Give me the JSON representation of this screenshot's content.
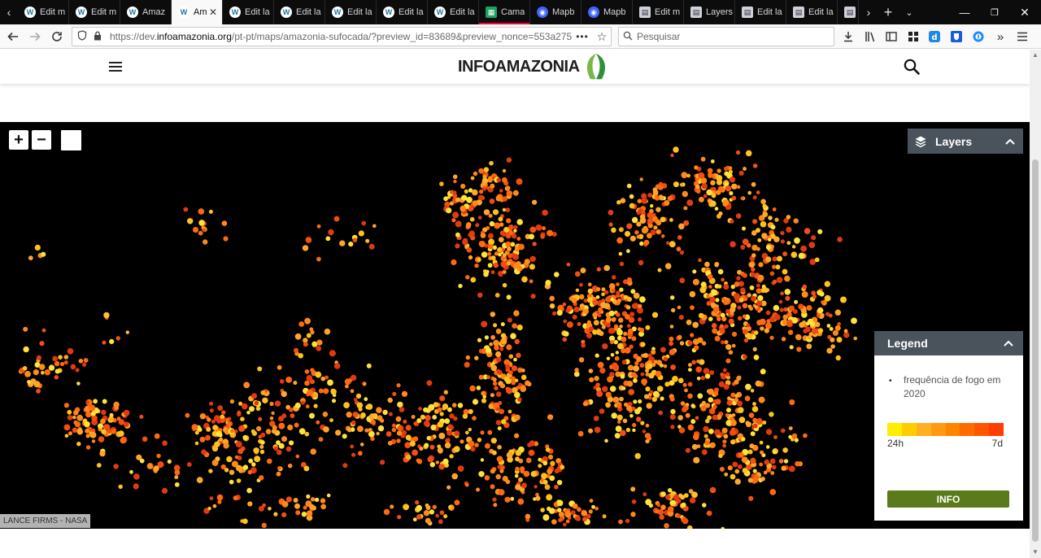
{
  "browser": {
    "tabs": [
      {
        "icon": "wordpress-icon",
        "title": "Edit m",
        "state": "normal"
      },
      {
        "icon": "wordpress-icon",
        "title": "Edit m",
        "state": "normal"
      },
      {
        "icon": "wordpress-icon",
        "title": "Amaz",
        "state": "normal"
      },
      {
        "icon": "wordpress-icon",
        "title": "Am",
        "state": "active"
      },
      {
        "icon": "wordpress-icon",
        "title": "Edit la",
        "state": "normal"
      },
      {
        "icon": "wordpress-icon",
        "title": "Edit la",
        "state": "normal"
      },
      {
        "icon": "wordpress-icon",
        "title": "Edit la",
        "state": "normal"
      },
      {
        "icon": "wordpress-icon",
        "title": "Edit la",
        "state": "normal"
      },
      {
        "icon": "wordpress-icon",
        "title": "Edit la",
        "state": "normal"
      },
      {
        "icon": "sheets-icon",
        "title": "Cama",
        "state": "highlight"
      },
      {
        "icon": "mapbox-icon",
        "title": "Mapb",
        "state": "normal"
      },
      {
        "icon": "mapbox-icon",
        "title": "Mapb",
        "state": "normal"
      },
      {
        "icon": "page-icon",
        "title": "Edit m",
        "state": "normal"
      },
      {
        "icon": "page-icon",
        "title": "Layers",
        "state": "normal"
      },
      {
        "icon": "page-icon",
        "title": "Edit la",
        "state": "normal"
      },
      {
        "icon": "page-icon",
        "title": "Edit la",
        "state": "normal"
      },
      {
        "icon": "page-icon",
        "title": "",
        "state": "normal"
      }
    ],
    "url_prefix": "https://dev.",
    "url_domain": "infoamazonia.org",
    "url_path": "/pt-pt/maps/amazonia-sufocada/?preview_id=83689&preview_nonce=553a27518",
    "search_placeholder": "Pesquisar"
  },
  "site": {
    "logo_text": "INFOAMAZONIA"
  },
  "map": {
    "zoom_in": "+",
    "zoom_out": "−",
    "attribution": "LANCE FIRMS - NASA",
    "layers_title": "Layers",
    "legend": {
      "title": "Legend",
      "layer_name": "frequência de fogo em 2020",
      "ramp_colors": [
        "#ffee00",
        "#ffcc00",
        "#ffb020",
        "#ff9a10",
        "#ff8400",
        "#ff6a00",
        "#ff5500",
        "#ff3d00"
      ],
      "min_label": "24h",
      "max_label": "7d",
      "info_button": "INFO"
    },
    "fire_colors": [
      "#ffe23a",
      "#ffc21f",
      "#ffa62a",
      "#ff8a1a",
      "#ff6a10",
      "#f24f12",
      "#e23a10"
    ]
  }
}
